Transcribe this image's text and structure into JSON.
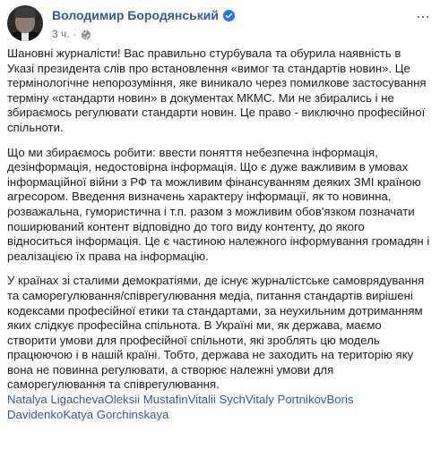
{
  "post": {
    "author": "Володимир Бородянський",
    "time": "3 ч.",
    "separator": "·",
    "verified_icon": "verified-badge-icon",
    "privacy_icon": "globe-icon",
    "more_icon": "more-options-icon",
    "more_label": "···",
    "paragraphs": [
      "Шановні журналісти! Вас правильно стурбувала та обурила наявність в Указі президента слів про встановлення «вимог та стандартів новин». Це термінологічне непорозуміння, яке виникало через помилкове застосування терміну «стандарти новин» в документах МКМС. Ми не збирались і не збираємось регулювати стандарти новин. Це право - виключно професійної спільноти.",
      "Що ми збираємось робити: ввести поняття небезпечна інформація, дезінформація, недостовірна інформація. Що є дуже важливим в умовах інформаційної війни з РФ та можливим фінансуванням деяких ЗМІ країною агресором. Введення визначень характеру інформації, як то новинна, розважальна, гумористична і т.п. разом з можливим обов'язком позначати поширюваний контент відповідно до того виду контенту, до якого відноситься інформація. Це є частиною належного інформування громадян і реалізацією їх права на інформацію.",
      "У країнах зі сталими демократіями, де існує журналістське самоврядування та саморегулювання/співрегулювання медіа, питання стандартів вирішені кодексами професійної етики та стандартами, за неухильним дотриманням яких слідкує професійна спільнота. В Україні ми, як держава, маємо створити умови для професійної спільноти, які зроблять цю модель працюючою і в нашій країні. Тобто, держава не заходить на територію яку вона не повинна регулювати, а створює належні умови для саморегулювання та співрегулювання."
    ],
    "tagged_people": [
      "Natalya Ligacheva",
      "Oleksii Mustafin",
      "Vitalii Sych",
      "Vitaly Portnikov",
      "Boris Davidenko",
      "Katya Gorchinskaya"
    ],
    "colors": {
      "link": "#385898",
      "text": "#1c1e21",
      "meta": "#616770",
      "verified": "#1877f2"
    }
  }
}
